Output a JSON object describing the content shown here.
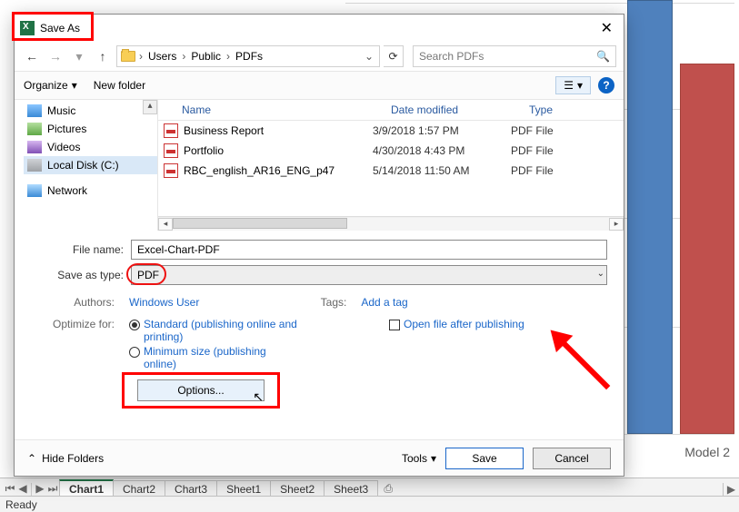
{
  "window": {
    "title": "Save As"
  },
  "nav": {
    "breadcrumb": [
      "Users",
      "Public",
      "PDFs"
    ],
    "search_placeholder": "Search PDFs"
  },
  "toolbar": {
    "organize": "Organize",
    "new_folder": "New folder"
  },
  "tree": {
    "items": [
      {
        "label": "Music",
        "icon": "music"
      },
      {
        "label": "Pictures",
        "icon": "pic"
      },
      {
        "label": "Videos",
        "icon": "vid"
      },
      {
        "label": "Local Disk (C:)",
        "icon": "drive",
        "selected": true
      },
      {
        "label": "Network",
        "icon": "net"
      }
    ]
  },
  "columns": {
    "name": "Name",
    "date": "Date modified",
    "type": "Type"
  },
  "files": [
    {
      "name": "Business Report",
      "date": "3/9/2018 1:57 PM",
      "type": "PDF File"
    },
    {
      "name": "Portfolio",
      "date": "4/30/2018 4:43 PM",
      "type": "PDF File"
    },
    {
      "name": "RBC_english_AR16_ENG_p47",
      "date": "5/14/2018 11:50 AM",
      "type": "PDF File"
    }
  ],
  "form": {
    "file_name_label": "File name:",
    "file_name_value": "Excel-Chart-PDF",
    "save_type_label": "Save as type:",
    "save_type_value": "PDF",
    "authors_label": "Authors:",
    "authors_value": "Windows User",
    "tags_label": "Tags:",
    "tags_value": "Add a tag",
    "optimize_label": "Optimize for:",
    "radio_standard": "Standard (publishing online and printing)",
    "radio_minimum": "Minimum size (publishing online)",
    "open_after": "Open file after publishing",
    "options_btn": "Options..."
  },
  "footer": {
    "hide_folders": "Hide Folders",
    "tools": "Tools",
    "save": "Save",
    "cancel": "Cancel"
  },
  "bg": {
    "model_label": "Model 2"
  },
  "tabs": {
    "items": [
      "Chart1",
      "Chart2",
      "Chart3",
      "Sheet1",
      "Sheet2",
      "Sheet3"
    ],
    "active_index": 0
  },
  "status": {
    "text": "Ready"
  }
}
